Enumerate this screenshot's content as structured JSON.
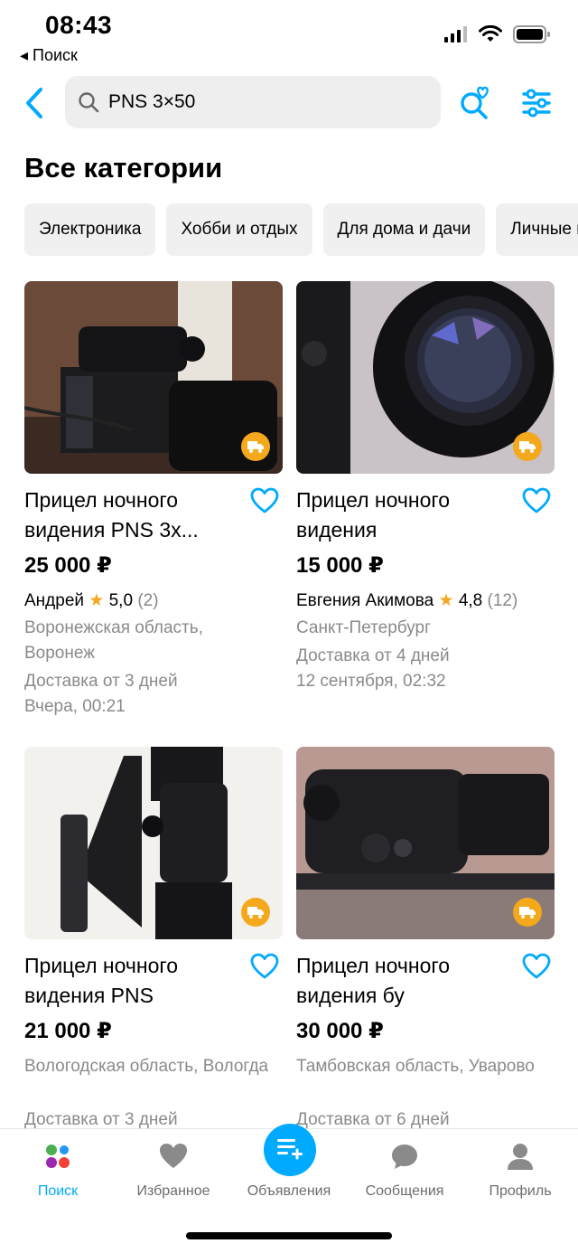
{
  "status": {
    "time": "08:43",
    "back_app": "◂ Поиск"
  },
  "search": {
    "query": "PNS 3×50"
  },
  "page_title": "Все категории",
  "categories": [
    "Электроника",
    "Хобби и отдых",
    "Для дома и дачи",
    "Личные вещи"
  ],
  "listings": [
    {
      "title": "Прицел ночного видения PNS 3х...",
      "price": "25 000 ₽",
      "seller": "Андрей",
      "rating": "5,0",
      "reviews": "(2)",
      "location": "Воронежская область, Воронеж",
      "delivery": "Доставка от 3 дней",
      "date": "Вчера, 00:21"
    },
    {
      "title": "Прицел ночного видения",
      "price": "15 000 ₽",
      "seller": "Евгения Акимова",
      "rating": "4,8",
      "reviews": "(12)",
      "location": "Санкт-Петербург",
      "delivery": "Доставка от 4 дней",
      "date": "12 сентября, 02:32"
    },
    {
      "title": "Прицел ночного видения PNS",
      "price": "21 000 ₽",
      "location": "Вологодская область, Вологда",
      "delivery": "Доставка от 3 дней"
    },
    {
      "title": "Прицел ночного видения бу",
      "price": "30 000 ₽",
      "location": "Тамбовская область, Уварово",
      "delivery": "Доставка от 6 дней"
    }
  ],
  "tabbar": {
    "search": "Поиск",
    "favorites": "Избранное",
    "ads": "Объявления",
    "messages": "Сообщения",
    "profile": "Профиль"
  },
  "colors": {
    "accent": "#00aaff",
    "badge": "#f4a81c",
    "star": "#f5a623"
  }
}
